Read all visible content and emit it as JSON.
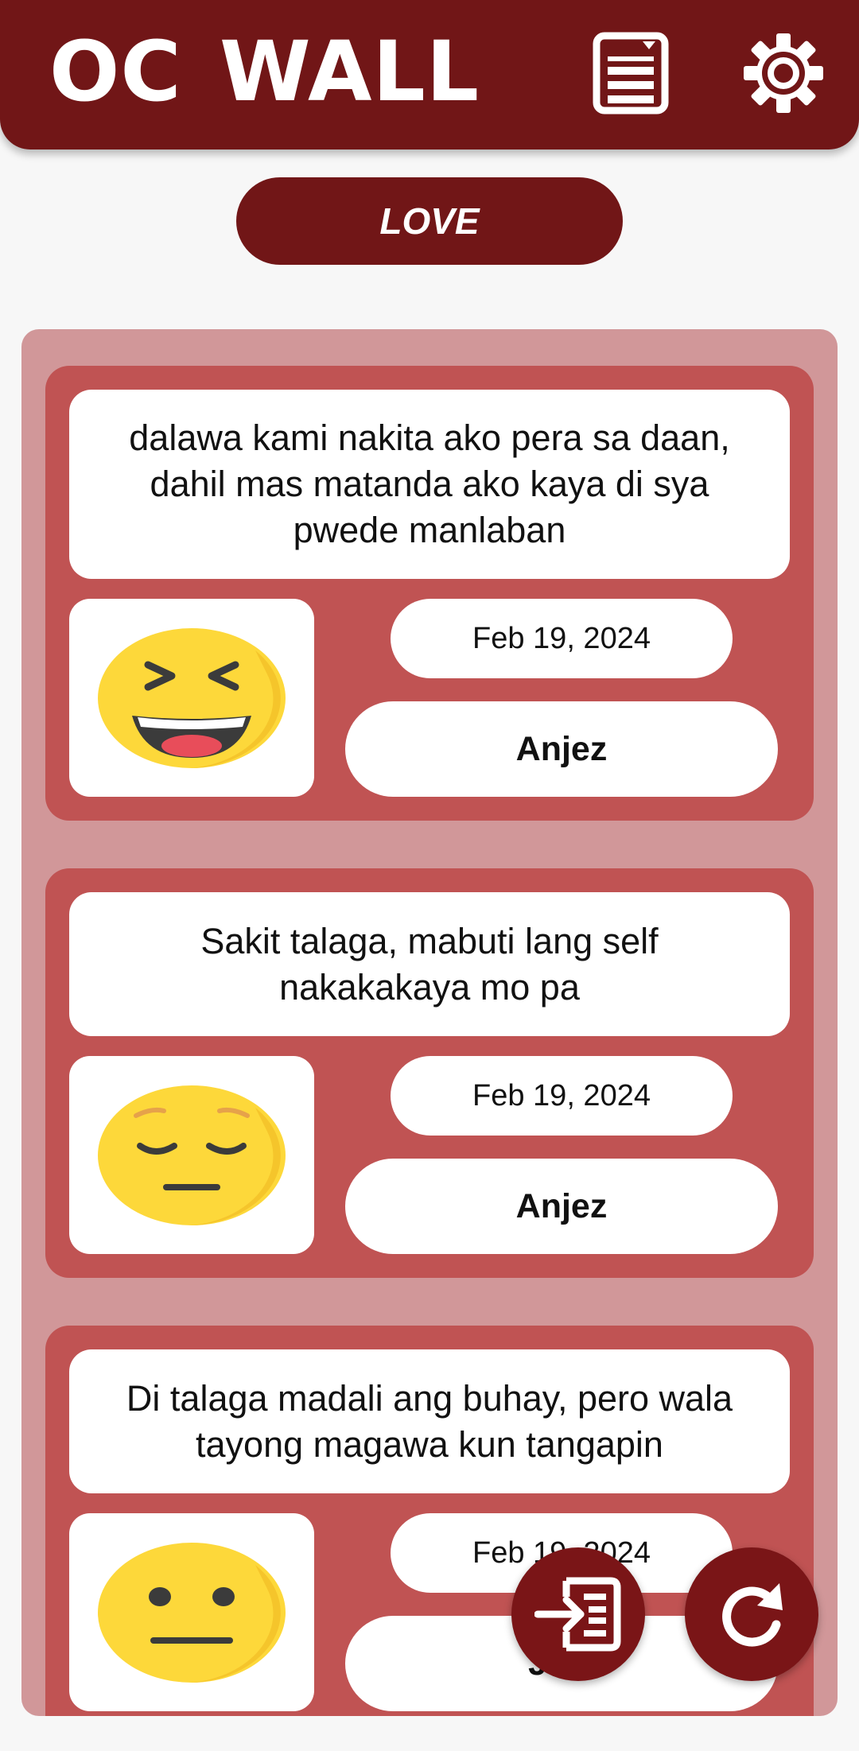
{
  "app": {
    "title": "OC WALL"
  },
  "header": {
    "icons": [
      "document-list-icon",
      "gear-icon"
    ]
  },
  "category": {
    "label": "LOVE"
  },
  "posts": [
    {
      "text": "dalawa kami nakita ako pera sa daan, dahil mas matanda ako kaya di sya pwede manlaban",
      "emoji": "laughing-face-icon",
      "date": "Feb 19, 2024",
      "author": "Anjez"
    },
    {
      "text": "Sakit talaga, mabuti lang self nakakakaya mo pa",
      "emoji": "pensive-face-icon",
      "date": "Feb 19, 2024",
      "author": "Anjez"
    },
    {
      "text": "Di talaga madali ang buhay, pero wala tayong magawa kun tangapin",
      "emoji": "neutral-face-icon",
      "date": "Feb 19, 2024",
      "author": "Jil..."
    }
  ],
  "fabs": [
    "post-input-icon",
    "refresh-icon"
  ],
  "colors": {
    "primary": "#711617",
    "card": "#c05353",
    "feed_bg": "#d19799",
    "emoji_yellow": "#fdd83a"
  }
}
